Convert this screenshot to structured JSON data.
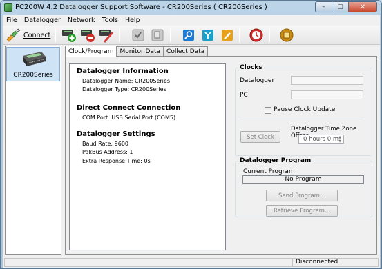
{
  "window": {
    "title": "PC200W 4.2 Datalogger Support Software - CR200Series ( CR200Series )",
    "controls": {
      "minimize": "–",
      "maximize": "▢",
      "close": "✕"
    }
  },
  "menu": [
    "File",
    "Datalogger",
    "Network",
    "Tools",
    "Help"
  ],
  "toolbar": {
    "connect_label": "Connect",
    "icons": [
      "connect-icon",
      "add-datalogger-icon",
      "remove-datalogger-icon",
      "edit-datalogger-icon",
      "check-icon",
      "copy-icon",
      "search-icon",
      "network-icon",
      "edit-note-icon",
      "clock-icon",
      "box-icon"
    ]
  },
  "stations": [
    {
      "label": "CR200Series"
    }
  ],
  "tabs": [
    {
      "label": "Clock/Program",
      "active": true
    },
    {
      "label": "Monitor Data",
      "active": false
    },
    {
      "label": "Collect Data",
      "active": false
    }
  ],
  "info": {
    "datalogger_title": "Datalogger Information",
    "datalogger_name": "Datalogger Name: CR200Series",
    "datalogger_type": "Datalogger Type: CR200Series",
    "connection_title": "Direct Connect Connection",
    "com_port": "COM Port: USB Serial Port (COM5)",
    "settings_title": "Datalogger Settings",
    "baud_rate": "Baud Rate: 9600",
    "pakbus": "PakBus Address: 1",
    "extra_response": "Extra Response Time: 0s"
  },
  "clocks": {
    "title": "Clocks",
    "datalogger_label": "Datalogger",
    "datalogger_value": "",
    "pc_label": "PC",
    "pc_value": "",
    "pause_label": "Pause Clock Update",
    "pause_checked": false,
    "set_clock_label": "Set Clock",
    "tz_label": "Datalogger Time Zone Offset",
    "tz_value": "0 hours 0 m"
  },
  "program": {
    "title": "Datalogger Program",
    "current_label": "Current Program",
    "current_value": "No Program",
    "send_label": "Send Program...",
    "retrieve_label": "Retrieve Program..."
  },
  "status": {
    "connection": "Disconnected"
  }
}
